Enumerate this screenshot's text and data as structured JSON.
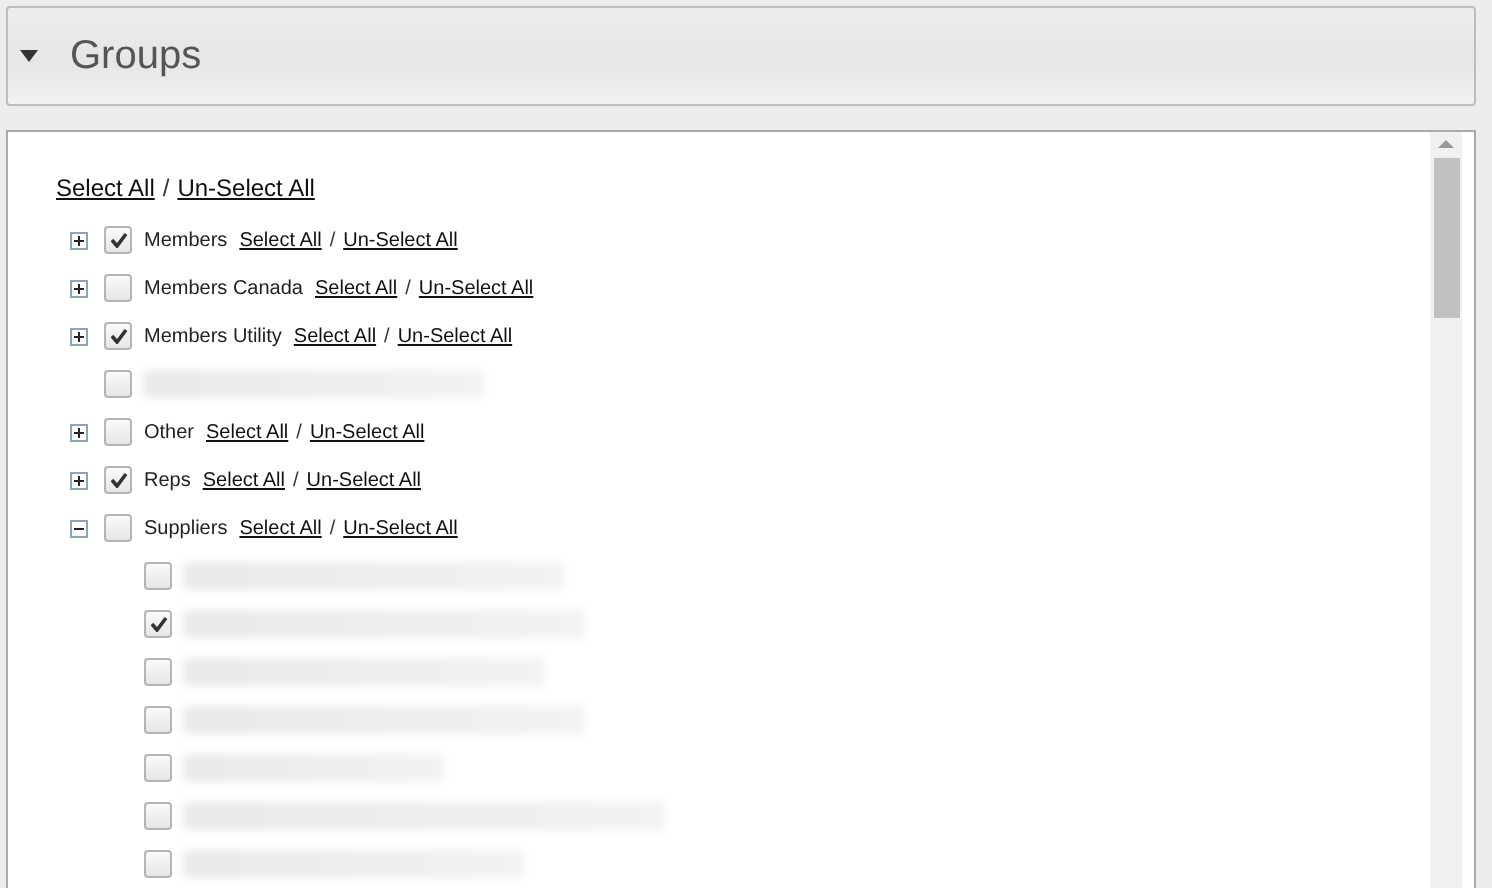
{
  "header": {
    "title": "Groups",
    "expanded": true
  },
  "select_all": {
    "select": "Select All",
    "separator": "/",
    "unselect": "Un-Select All"
  },
  "groups": [
    {
      "kind": "group",
      "label": "Members",
      "checked": true,
      "expanded": false,
      "select": "Select All",
      "separator": "/",
      "unselect": "Un-Select All"
    },
    {
      "kind": "group",
      "label": "Members Canada",
      "checked": false,
      "expanded": false,
      "select": "Select All",
      "separator": "/",
      "unselect": "Un-Select All"
    },
    {
      "kind": "group",
      "label": "Members Utility",
      "checked": true,
      "expanded": false,
      "select": "Select All",
      "separator": "/",
      "unselect": "Un-Select All"
    },
    {
      "kind": "redacted",
      "checked": false
    },
    {
      "kind": "group",
      "label": "Other",
      "checked": false,
      "expanded": false,
      "select": "Select All",
      "separator": "/",
      "unselect": "Un-Select All"
    },
    {
      "kind": "group",
      "label": "Reps",
      "checked": true,
      "expanded": false,
      "select": "Select All",
      "separator": "/",
      "unselect": "Un-Select All"
    },
    {
      "kind": "group",
      "label": "Suppliers",
      "checked": false,
      "expanded": true,
      "select": "Select All",
      "separator": "/",
      "unselect": "Un-Select All",
      "children": [
        {
          "kind": "redacted",
          "checked": false
        },
        {
          "kind": "redacted",
          "checked": true
        },
        {
          "kind": "redacted",
          "checked": false
        },
        {
          "kind": "redacted",
          "checked": false
        },
        {
          "kind": "redacted",
          "checked": false
        },
        {
          "kind": "redacted",
          "checked": false
        },
        {
          "kind": "redacted",
          "checked": false
        }
      ]
    }
  ]
}
